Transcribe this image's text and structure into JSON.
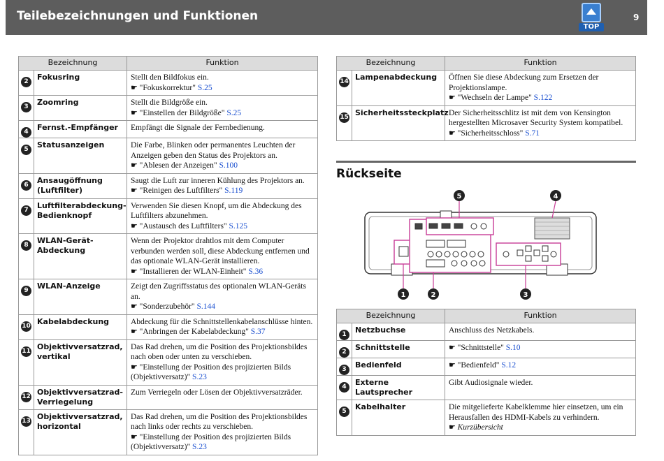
{
  "header": {
    "title": "Teilebezeichnungen und Funktionen",
    "top_label": "TOP",
    "page_number": "9"
  },
  "columns": {
    "name": "Bezeichnung",
    "function": "Funktion"
  },
  "left_rows": [
    {
      "num": "2",
      "name": "Fokusring",
      "lines": [
        "Stellt den Bildfokus ein."
      ],
      "ref_text": "\"Fokuskorrektur\"",
      "ref_page": "S.25"
    },
    {
      "num": "3",
      "name": "Zoomring",
      "lines": [
        "Stellt die Bildgröße ein."
      ],
      "ref_text": "\"Einstellen der Bildgröße\"",
      "ref_page": "S.25"
    },
    {
      "num": "4",
      "name": "Fernst.-Empfänger",
      "lines": [
        "Empfängt die Signale der Fernbedienung."
      ]
    },
    {
      "num": "5",
      "name": "Statusanzeigen",
      "lines": [
        "Die Farbe, Blinken oder permanentes Leuchten der",
        "Anzeigen geben den Status des Projektors an."
      ],
      "ref_text": "\"Ablesen der Anzeigen\"",
      "ref_page": "S.100"
    },
    {
      "num": "6",
      "name": "Ansaugöffnung (Luftfilter)",
      "lines": [
        "Saugt die Luft zur inneren Kühlung des Projektors an."
      ],
      "ref_text": "\"Reinigen des Luftfilters\"",
      "ref_page": "S.119"
    },
    {
      "num": "7",
      "name": "Luftfilterabdeckung-Bedienknopf",
      "lines": [
        "Verwenden Sie diesen Knopf, um die Abdeckung des",
        "Luftfilters abzunehmen."
      ],
      "ref_text": "\"Austausch des Luftfilters\"",
      "ref_page": "S.125"
    },
    {
      "num": "8",
      "name": "WLAN-Gerät-Abdeckung",
      "lines": [
        "Wenn der Projektor drahtlos mit dem Computer",
        "verbunden werden soll, diese Abdeckung entfernen und",
        "das optionale WLAN-Gerät installieren."
      ],
      "ref_text": "\"Installieren der WLAN-Einheit\"",
      "ref_page": "S.36"
    },
    {
      "num": "9",
      "name": "WLAN-Anzeige",
      "lines": [
        "Zeigt den Zugriffsstatus des optionalen WLAN-Geräts an."
      ],
      "ref_text": "\"Sonderzubehör\"",
      "ref_page": "S.144"
    },
    {
      "num": "10",
      "name": "Kabelabdeckung",
      "lines": [
        "Abdeckung für die Schnittstellenkabelanschlüsse hinten."
      ],
      "ref_text": "\"Anbringen der Kabelabdeckung\"",
      "ref_page": "S.37"
    },
    {
      "num": "11",
      "name": "Objektivversatzrad, vertikal",
      "lines": [
        "Das Rad drehen, um die Position des Projektionsbildes",
        "nach oben oder unten zu verschieben."
      ],
      "ref_text": "\"Einstellung der Position des projizierten Bilds (Objektivversatz)\"",
      "ref_page": "S.23"
    },
    {
      "num": "12",
      "name": "Objektivversatzrad-Verriegelung",
      "lines": [
        "Zum Verriegeln oder Lösen der Objektivversatzräder."
      ]
    },
    {
      "num": "13",
      "name": "Objektivversatzrad, horizontal",
      "lines": [
        "Das Rad drehen, um die Position des Projektionsbildes",
        "nach links oder rechts zu verschieben."
      ],
      "ref_text": "\"Einstellung der Position des projizierten Bilds (Objektivversatz)\"",
      "ref_page": "S.23"
    }
  ],
  "right_rows": [
    {
      "num": "14",
      "name": "Lampenabdeckung",
      "lines": [
        "Öffnen Sie diese Abdeckung zum Ersetzen der",
        "Projektionslampe."
      ],
      "ref_text": "\"Wechseln der Lampe\"",
      "ref_page": "S.122"
    },
    {
      "num": "15",
      "name": "Sicherheitssteckplatz",
      "lines": [
        "Der Sicherheitsschlitz ist mit dem von Kensington",
        "hergestellten Microsaver Security System kompatibel."
      ],
      "ref_text": "\"Sicherheitsschloss\"",
      "ref_page": "S.71"
    }
  ],
  "rear_section": {
    "title": "Rückseite",
    "callouts": [
      "1",
      "2",
      "3",
      "4",
      "5"
    ]
  },
  "rear_rows": [
    {
      "num": "1",
      "name": "Netzbuchse",
      "lines": [
        "Anschluss des Netzkabels."
      ]
    },
    {
      "num": "2",
      "name": "Schnittstelle",
      "lines": [],
      "ref_text": "\"Schnittstelle\"",
      "ref_page": "S.10"
    },
    {
      "num": "3",
      "name": "Bedienfeld",
      "lines": [],
      "ref_text": "\"Bedienfeld\"",
      "ref_page": "S.12"
    },
    {
      "num": "4",
      "name": "Externe Lautsprecher",
      "lines": [
        "Gibt Audiosignale wieder."
      ]
    },
    {
      "num": "5",
      "name": "Kabelhalter",
      "lines": [
        "Die mitgelieferte Kabelklemme hier einsetzen, um ein",
        "Herausfallen des HDMI-Kabels zu verhindern."
      ],
      "ref_italic": "Kurzübersicht"
    }
  ]
}
